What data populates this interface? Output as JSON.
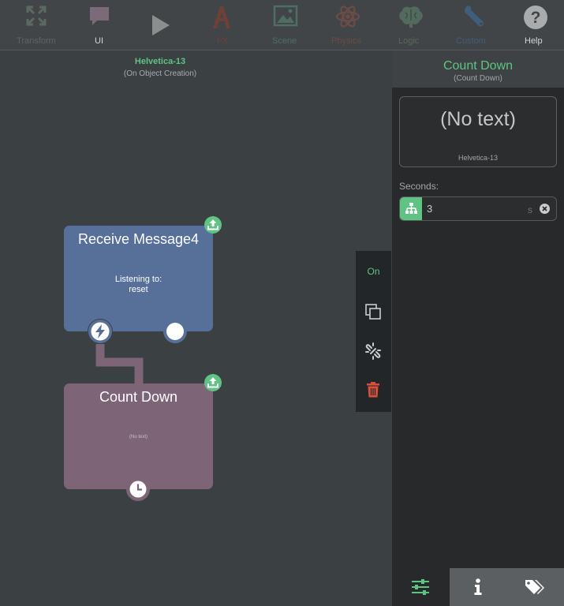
{
  "toolbar": {
    "items": [
      {
        "label": "Transform",
        "icon": "transform-icon"
      },
      {
        "label": "UI",
        "icon": "speech-bubble-icon"
      },
      {
        "label": "",
        "icon": "play-icon"
      },
      {
        "label": "FX",
        "icon": "fx-icon"
      },
      {
        "label": "Scene",
        "icon": "image-icon"
      },
      {
        "label": "Physics",
        "icon": "atom-icon"
      },
      {
        "label": "Logic",
        "icon": "brain-icon"
      },
      {
        "label": "Custom",
        "icon": "wrench-icon"
      },
      {
        "label": "Help",
        "icon": "help-icon"
      }
    ]
  },
  "canvas": {
    "object_name": "Helvetica-13",
    "trigger": "(On Object Creation)",
    "nodes": {
      "receive": {
        "title": "Receive Message4",
        "line1": "Listening to:",
        "line2": "reset"
      },
      "countdown": {
        "title": "Count Down",
        "body": "(No text)"
      }
    }
  },
  "context_menu": {
    "on_label": "On"
  },
  "panel": {
    "title": "Count Down",
    "subtitle": "(Count Down)",
    "preview_text": "(No text)",
    "preview_object": "Helvetica-13",
    "seconds_label": "Seconds:",
    "seconds_value": "3",
    "seconds_unit": "s"
  },
  "colors": {
    "accent_green": "#5fc483",
    "receive_node": "#56709a",
    "countdown_node": "#7d6577",
    "delete_red": "#d9503a"
  }
}
